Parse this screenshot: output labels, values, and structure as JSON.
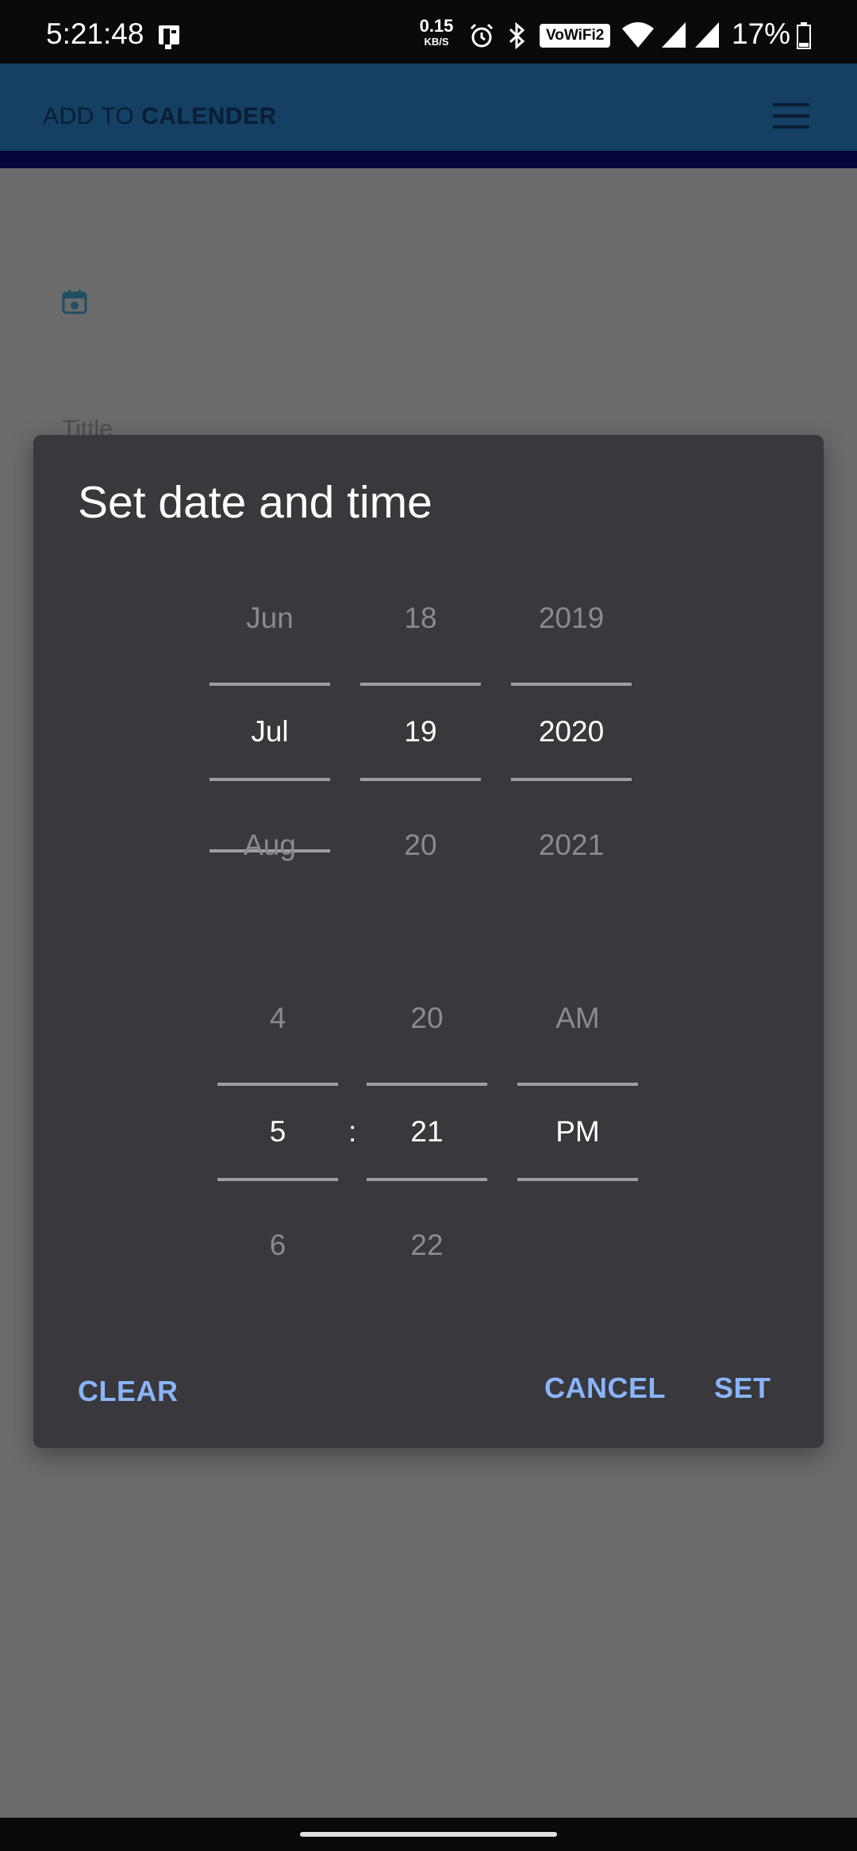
{
  "status_bar": {
    "time": "5:21:48",
    "speed_value": "0.15",
    "speed_unit": "KB/S",
    "vowifi": "VoWiFi2",
    "battery": "17%",
    "icons": [
      "sim-card-icon",
      "alarm-icon",
      "bluetooth-icon",
      "wifi-icon",
      "signal-icon",
      "signal-icon",
      "battery-icon"
    ]
  },
  "app_bar": {
    "title_prefix": "ADD TO ",
    "title_bold": "CALENDER",
    "menu_icon": "hamburger-menu-icon"
  },
  "background": {
    "field_label": "Tittle",
    "icon": "calendar-icon"
  },
  "dialog": {
    "title": "Set date and time",
    "date": {
      "month": {
        "prev": "Jun",
        "selected": "Jul",
        "next": "Aug"
      },
      "day": {
        "prev": "18",
        "selected": "19",
        "next": "20"
      },
      "year": {
        "prev": "2019",
        "selected": "2020",
        "next": "2021"
      }
    },
    "time": {
      "hour": {
        "prev": "4",
        "selected": "5",
        "next": "6"
      },
      "separator": ":",
      "minute": {
        "prev": "20",
        "selected": "21",
        "next": "22"
      },
      "ampm": {
        "prev": "AM",
        "selected": "PM",
        "next": ""
      }
    },
    "buttons": {
      "clear": "CLEAR",
      "cancel": "CANCEL",
      "set": "SET"
    },
    "accent_color": "#8ab4f8"
  }
}
